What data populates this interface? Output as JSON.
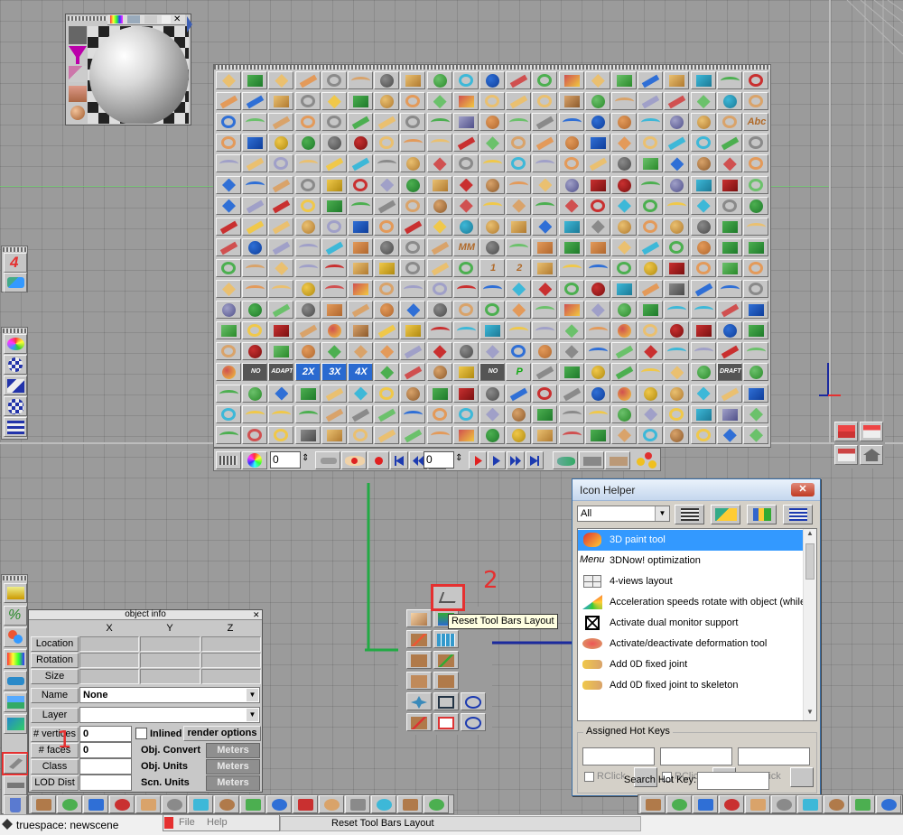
{
  "app": {
    "title": "truespace: newscene",
    "menu": {
      "file": "File",
      "help": "Help"
    },
    "status_text": "Reset Tool Bars Layout"
  },
  "tooltip": "Reset Tool Bars Layout",
  "annotations": {
    "one": "1",
    "two": "2",
    "four": "4"
  },
  "main_palette": {
    "badges": [
      "Abc",
      "Abc",
      "MM",
      "1",
      "2",
      "NO ANTI",
      "ADAPT",
      "2X",
      "3X",
      "4X",
      "NO FOR",
      "P",
      "DRAFT"
    ],
    "frame_value_1": "0",
    "frame_value_2": "0"
  },
  "icon_helper": {
    "title": "Icon Helper",
    "close": "✕",
    "filter": "All",
    "items": [
      {
        "label": "3D paint tool",
        "selected": true,
        "icon": "paint-icon"
      },
      {
        "label": "3DNow! optimization",
        "selected": false,
        "icon": "menu-icon",
        "icon_text": "Menu"
      },
      {
        "label": "4-views layout",
        "selected": false,
        "icon": "four-views-icon"
      },
      {
        "label": "Acceleration speeds rotate with object (while e",
        "selected": false,
        "icon": "acceleration-icon"
      },
      {
        "label": "Activate dual monitor support",
        "selected": false,
        "icon": "dual-monitor-icon"
      },
      {
        "label": "Activate/deactivate deformation tool",
        "selected": false,
        "icon": "deformation-icon"
      },
      {
        "label": "Add 0D fixed joint",
        "selected": false,
        "icon": "fixed-joint-icon"
      },
      {
        "label": "Add 0D fixed joint to skeleton",
        "selected": false,
        "icon": "fixed-joint-skeleton-icon"
      }
    ],
    "hotkeys_legend": "Assigned Hot Keys",
    "rclick": "RClick",
    "search_label": "Search Hot Key:"
  },
  "object_info": {
    "title": "object info",
    "axes": [
      "X",
      "Y",
      "Z"
    ],
    "rows": [
      "Location",
      "Rotation",
      "Size"
    ],
    "name_label": "Name",
    "name_value": "None",
    "layer_label": "Layer",
    "vertices_label": "# vertices",
    "vertices_value": "0",
    "faces_label": "# faces",
    "faces_value": "0",
    "class_label": "Class",
    "lod_label": "LOD Dist",
    "inlined_label": "Inlined",
    "render_options": "render options",
    "obj_convert": "Obj. Convert",
    "obj_units": "Obj. Units",
    "scn_units": "Scn. Units",
    "meters": "Meters"
  },
  "colors": {
    "accent_red": "#e53030",
    "selection_blue": "#3399ff",
    "axis_green": "#22aa44",
    "axis_blue": "#1b2a9e"
  }
}
